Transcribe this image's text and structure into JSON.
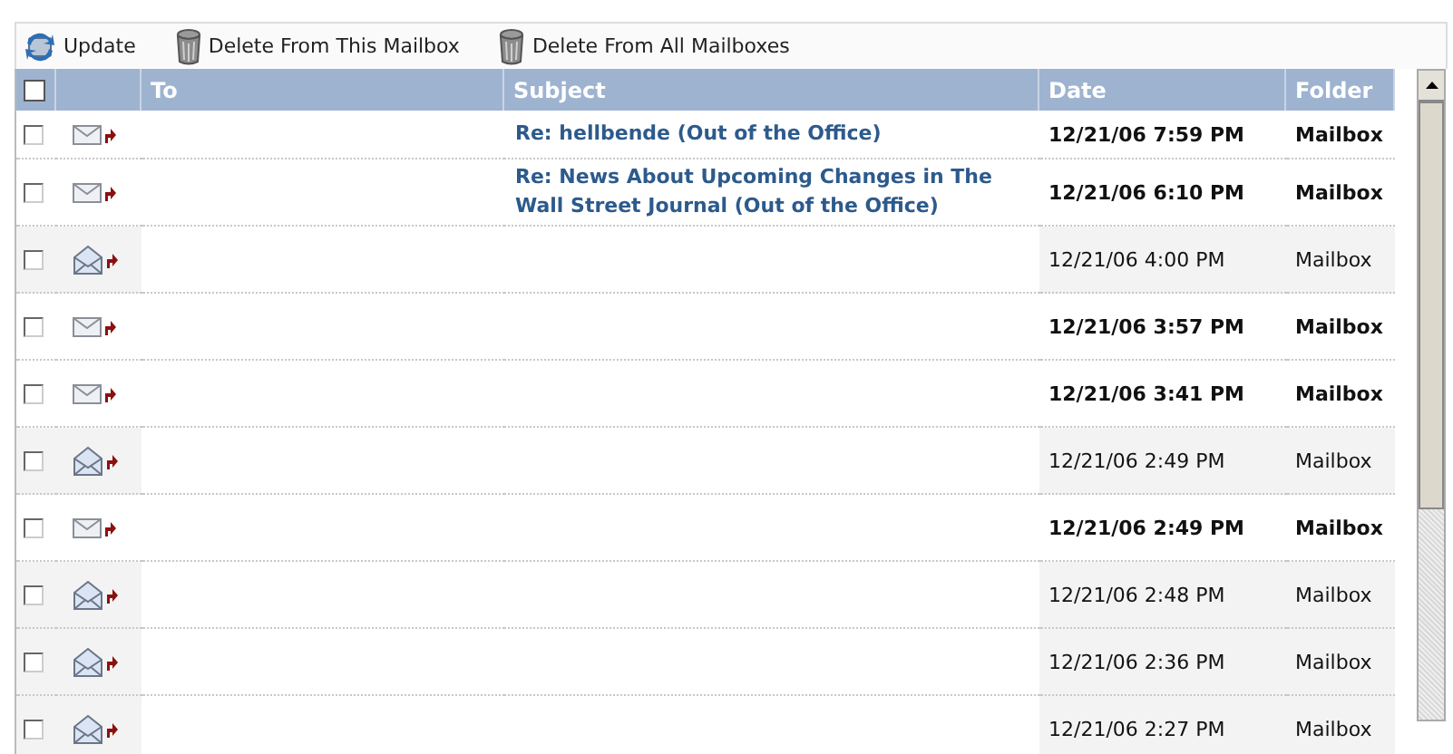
{
  "toolbar": [
    {
      "kind": "refresh",
      "label": "Update"
    },
    {
      "kind": "trash",
      "label": "Delete From This Mailbox"
    },
    {
      "kind": "trash",
      "label": "Delete From All Mailboxes"
    }
  ],
  "table": {
    "select_all": {
      "checked": false
    },
    "columns": [
      "To",
      "Subject",
      "Date",
      "Folder"
    ],
    "rows": [
      {
        "checked": false,
        "read": false,
        "subject": "Re: hellbende (Out of the Office)",
        "date": "12/21/06 7:59 PM",
        "folder": "Mailbox"
      },
      {
        "checked": false,
        "read": false,
        "subject": "Re: News About Upcoming Changes in The Wall Street Journal (Out of the Office)",
        "date": "12/21/06 6:10 PM",
        "folder": "Mailbox"
      },
      {
        "checked": false,
        "read": true,
        "date": "12/21/06 4:00 PM",
        "folder": "Mailbox"
      },
      {
        "checked": false,
        "read": false,
        "date": "12/21/06 3:57 PM",
        "folder": "Mailbox"
      },
      {
        "checked": false,
        "read": false,
        "date": "12/21/06 3:41 PM",
        "folder": "Mailbox"
      },
      {
        "checked": false,
        "read": true,
        "date": "12/21/06 2:49 PM",
        "folder": "Mailbox"
      },
      {
        "checked": false,
        "read": false,
        "date": "12/21/06 2:49 PM",
        "folder": "Mailbox"
      },
      {
        "checked": false,
        "read": true,
        "date": "12/21/06 2:48 PM",
        "folder": "Mailbox"
      },
      {
        "checked": false,
        "read": true,
        "date": "12/21/06 2:36 PM",
        "folder": "Mailbox"
      },
      {
        "checked": false,
        "read": true,
        "date": "12/21/06 2:27 PM",
        "folder": "Mailbox"
      }
    ]
  }
}
